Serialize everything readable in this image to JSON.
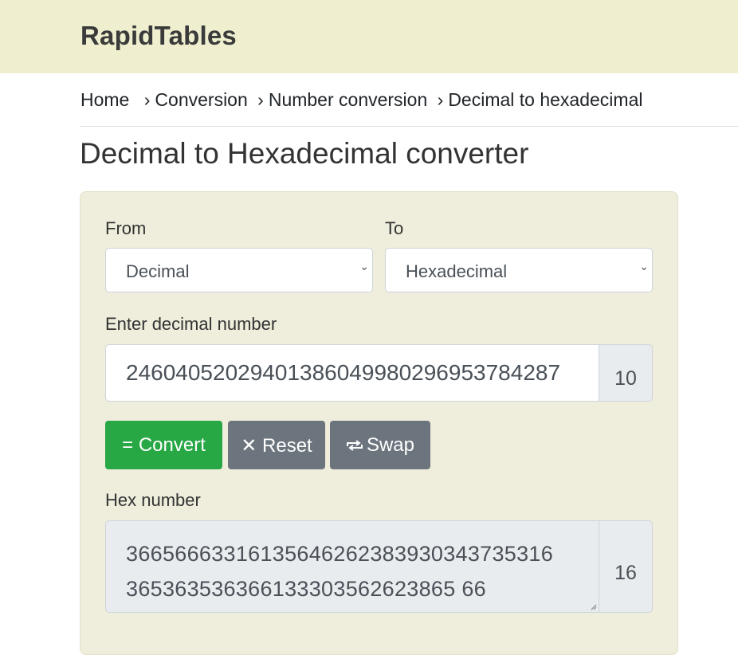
{
  "header": {
    "logo": "RapidTables"
  },
  "breadcrumb": {
    "items": [
      "Home",
      "Conversion",
      "Number conversion",
      "Decimal to hexadecimal"
    ],
    "separator": "›"
  },
  "page": {
    "title": "Decimal to Hexadecimal converter"
  },
  "converter": {
    "from_label": "From",
    "from_value": "Decimal",
    "to_label": "To",
    "to_value": "Hexadecimal",
    "input_label": "Enter decimal number",
    "input_value": "24604052029401386049980296953784287",
    "input_base": "10",
    "buttons": {
      "convert": "= Convert",
      "reset": "✕ Reset",
      "swap": "Swap"
    },
    "output_label": "Hex number",
    "output_lines": [
      "36656663316135646262383930343735316",
      "365363536366133303562623865 66"
    ],
    "output_base": "16"
  },
  "colors": {
    "header_bg": "#efefd0",
    "panel_bg": "#efeddb",
    "convert_button": "#28a745",
    "gray_button": "#6c757d"
  }
}
